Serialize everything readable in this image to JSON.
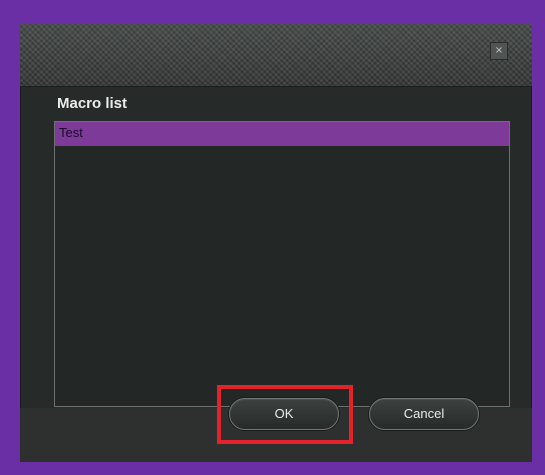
{
  "dialog": {
    "close_glyph": "×",
    "list_title": "Macro list",
    "items": [
      {
        "label": "Test",
        "selected": true
      }
    ],
    "ok_label": "OK",
    "cancel_label": "Cancel"
  },
  "colors": {
    "background": "#6a2fa4",
    "dialog": "#262a29",
    "selection": "#7d3a98",
    "highlight": "#e3232c"
  }
}
